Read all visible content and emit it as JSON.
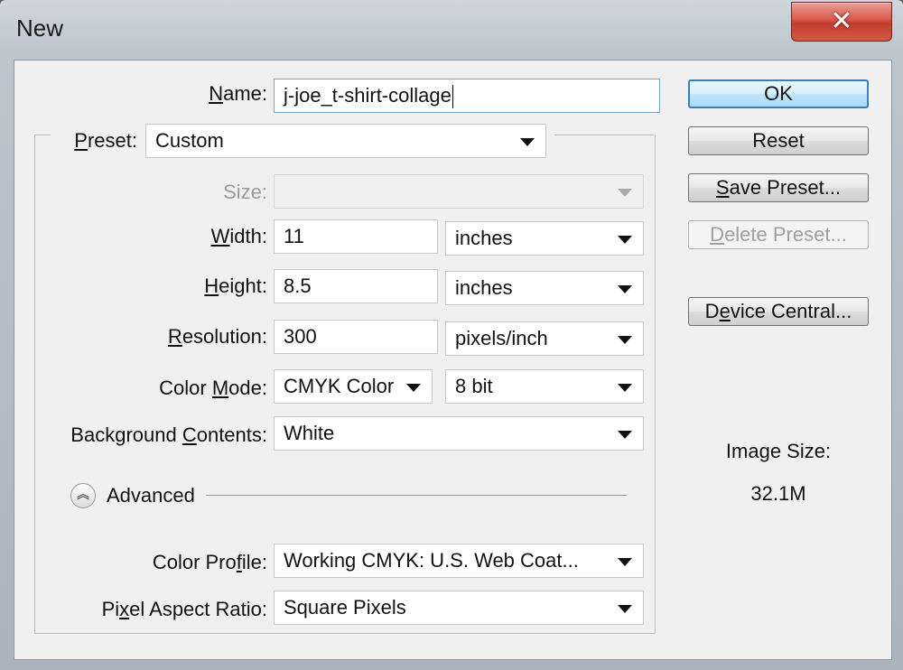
{
  "window": {
    "title": "New",
    "close_glyph": "✕"
  },
  "form": {
    "name": {
      "label_u": "N",
      "label_rest": "ame:",
      "value": "j-joe_t-shirt-collage"
    },
    "preset": {
      "label_u": "P",
      "label_rest": "reset:",
      "value": "Custom"
    },
    "size": {
      "label": "Size:",
      "value": ""
    },
    "width": {
      "label_u": "W",
      "label_rest": "idth:",
      "value": "11",
      "unit": "inches"
    },
    "height": {
      "label_u": "H",
      "label_rest": "eight:",
      "value": "8.5",
      "unit": "inches"
    },
    "resolution": {
      "label_u": "R",
      "label_rest": "esolution:",
      "value": "300",
      "unit": "pixels/inch"
    },
    "color_mode": {
      "label_pre": "Color ",
      "label_u": "M",
      "label_rest": "ode:",
      "value": "CMYK Color",
      "bits": "8 bit"
    },
    "background": {
      "label_pre": "Background ",
      "label_u": "C",
      "label_rest": "ontents:",
      "value": "White"
    },
    "advanced": {
      "label": "Advanced",
      "icon": "double-chevron-up-icon"
    },
    "color_profile": {
      "label_pre": "Color Pro",
      "label_u": "f",
      "label_rest": "ile:",
      "value": "Working CMYK:  U.S. Web Coat..."
    },
    "pixel_aspect": {
      "label_pre": "Pi",
      "label_u": "x",
      "label_rest": "el Aspect Ratio:",
      "value": "Square Pixels"
    }
  },
  "buttons": {
    "ok": "OK",
    "reset": "Reset",
    "save_preset_u": "S",
    "save_preset_rest": "ave Preset...",
    "delete_preset_u": "D",
    "delete_preset_rest": "elete Preset...",
    "device_central_pre": "D",
    "device_central_u": "e",
    "device_central_rest": "vice Central..."
  },
  "image_size": {
    "label": "Image Size:",
    "value": "32.1M"
  }
}
